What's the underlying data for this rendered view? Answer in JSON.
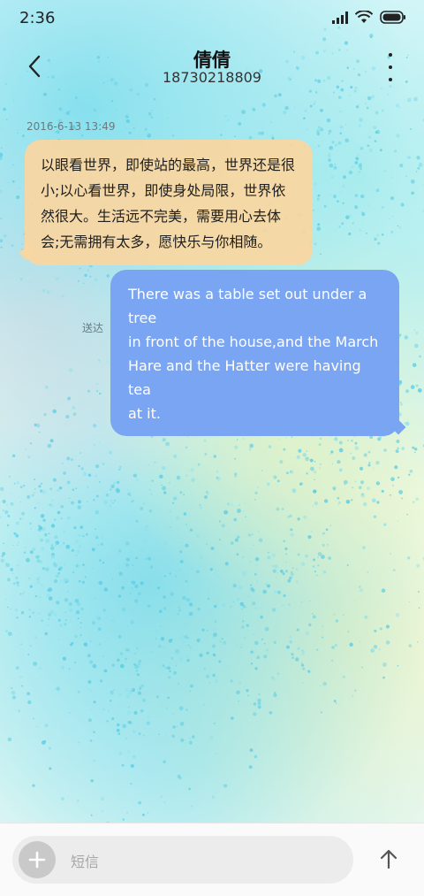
{
  "status_bar": {
    "time": "2:36",
    "icons": [
      "signal-icon",
      "wifi-icon",
      "battery-icon"
    ]
  },
  "header": {
    "contact_name": "倩倩",
    "phone_number": "18730218809",
    "back_icon": "chevron-left-icon",
    "menu_icon": "more-vertical-icon"
  },
  "conversation": {
    "timestamp": "2016-6-13 13:49",
    "received_message": {
      "lines": [
        "以眼看世界，即使站的最高，世界还是很",
        "小;以心看世界，即使身处局限，世界依",
        "然很大。生活远不完美，需要用心去体",
        "会;无需拥有太多，愿快乐与你相随。"
      ],
      "bubble_color": "#fad6a0"
    },
    "sent_message": {
      "status": "送达",
      "lines": [
        "There was a table set out under a tree",
        "in front of the house,and the March",
        "Hare and the Hatter were having tea",
        "at it."
      ],
      "bubble_color": "#7aa5f2"
    }
  },
  "composer": {
    "placeholder": "短信",
    "add_icon": "plus-icon",
    "send_icon": "arrow-up-icon"
  }
}
